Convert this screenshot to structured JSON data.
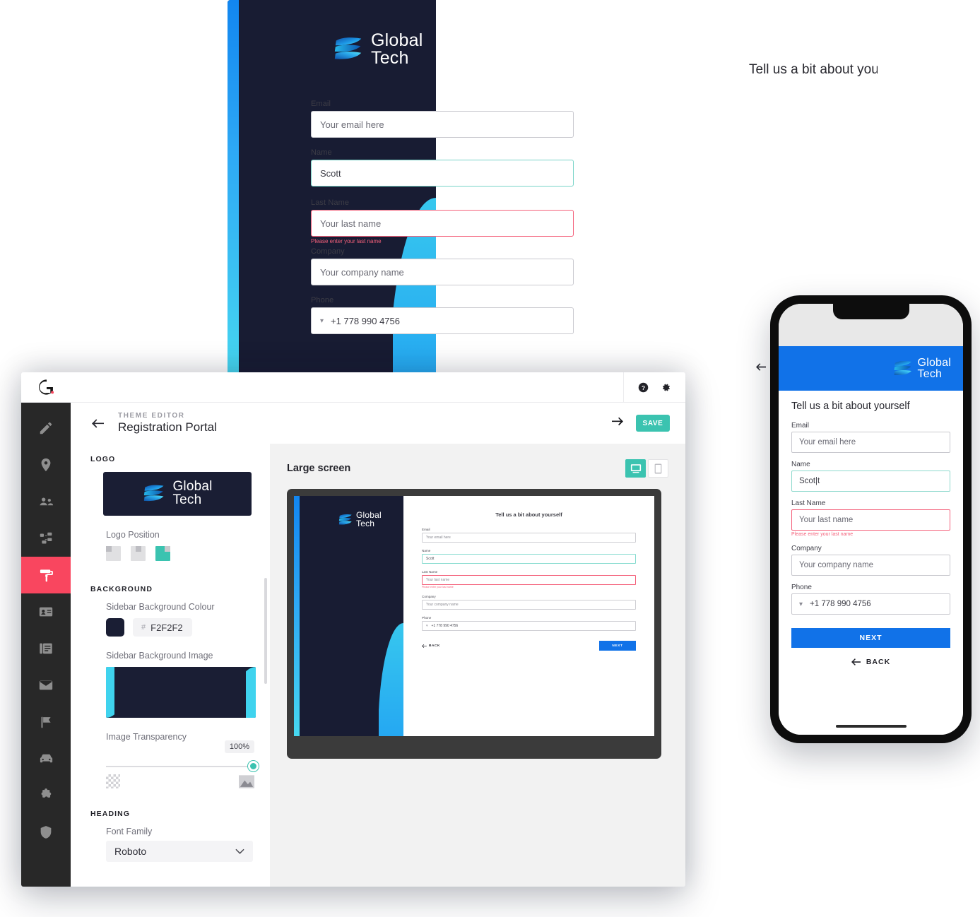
{
  "brand": {
    "logo_line1": "Global",
    "logo_line2": "Tech",
    "logo_icon": "global-tech-ribbon-logo",
    "app_logo_icon": "app-dot-logo",
    "sidebar_navy": "#181C33",
    "accent_cyan": "#3FD3EE",
    "accent_blue": "#1172E8",
    "teal": "#3BC3B0",
    "red": "#F9465F",
    "error_pink": "#F4607A"
  },
  "registration_form": {
    "heading": "Tell us a bit about yourself",
    "fields": [
      {
        "label": "Email",
        "value": "Your email here",
        "state": "empty",
        "filled": false
      },
      {
        "label": "Name",
        "value": "Scott",
        "state": "valid",
        "filled": true
      },
      {
        "label": "Last Name",
        "value": "Your last name",
        "state": "invalid",
        "filled": false,
        "error": "Please enter your last name"
      },
      {
        "label": "Company",
        "value": "Your company name",
        "state": "empty",
        "filled": false
      },
      {
        "label": "Phone",
        "value": "+1 778 990 4756",
        "state": "empty",
        "filled": true,
        "prefix_icon": "caret-down-icon"
      }
    ],
    "next_label": "NEXT",
    "back_label": "BACK",
    "back_icon": "arrow-left-icon"
  },
  "mobile_form": {
    "heading": "Tell us a bit about yourself",
    "name_value": "Scot|t",
    "next_label": "NEXT",
    "back_label": "BACK"
  },
  "editor": {
    "topbar": {
      "help_icon": "help-circle-icon",
      "settings_icon": "gear-icon"
    },
    "header": {
      "back_icon": "arrow-left-icon",
      "eyebrow": "THEME EDITOR",
      "title": "Registration Portal",
      "forward_icon": "arrow-right-icon",
      "save_label": "SAVE"
    },
    "rail": [
      {
        "name": "pencil-icon",
        "label": "Edit",
        "active": false
      },
      {
        "name": "pin-icon",
        "label": "Locations",
        "active": false
      },
      {
        "name": "people-icon",
        "label": "Visitors",
        "active": false
      },
      {
        "name": "sitemap-icon",
        "label": "Workflows",
        "active": false
      },
      {
        "name": "paint-roller-icon",
        "label": "Theme",
        "active": true
      },
      {
        "name": "badge-icon",
        "label": "Badges",
        "active": false
      },
      {
        "name": "documents-icon",
        "label": "Documents",
        "active": false
      },
      {
        "name": "envelope-icon",
        "label": "Messages",
        "active": false
      },
      {
        "name": "flag-icon",
        "label": "Reports",
        "active": false
      },
      {
        "name": "car-icon",
        "label": "Parking",
        "active": false
      },
      {
        "name": "puzzle-icon",
        "label": "Integrations",
        "active": false
      },
      {
        "name": "shield-icon",
        "label": "Security",
        "active": false
      }
    ],
    "panel": {
      "logo_section": "LOGO",
      "logo_position_label": "Logo Position",
      "logo_positions": [
        {
          "value": "left",
          "selected": false
        },
        {
          "value": "center",
          "selected": false
        },
        {
          "value": "right",
          "selected": true
        }
      ],
      "background_section": "BACKGROUND",
      "sidebar_bg_colour_label": "Sidebar Background Colour",
      "sidebar_bg_colour_hex": "F2F2F2",
      "sidebar_bg_swatch": "#1A1E34",
      "sidebar_bg_image_label": "Sidebar Background Image",
      "image_transparency_label": "Image Transparency",
      "image_transparency_value": "100%",
      "transparency_min_icon": "checkerboard-icon",
      "transparency_max_icon": "image-icon",
      "heading_section": "HEADING",
      "font_family_label": "Font Family",
      "font_family_value": "Roboto",
      "font_family_chevron": "chevron-down-icon"
    },
    "preview": {
      "title": "Large screen",
      "toggle": [
        {
          "name": "desktop-icon",
          "selected": true
        },
        {
          "name": "mobile-icon",
          "selected": false
        }
      ]
    }
  }
}
